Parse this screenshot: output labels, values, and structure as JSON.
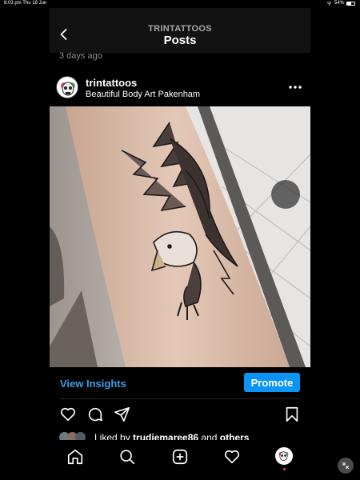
{
  "status_bar": {
    "time_date": "8:03 pm  Thu 18 Jun",
    "battery_text": "54%"
  },
  "header": {
    "account": "TRINTATTOOS",
    "title": "Posts"
  },
  "previous_post": {
    "time_ago": "3 days ago"
  },
  "post": {
    "username": "trintattoos",
    "location": "Beautiful Body Art Pakenham",
    "image_description_icon": "eagle-tattoo-photo"
  },
  "insights": {
    "view_label": "View Insights",
    "promote_label": "Promote"
  },
  "likes": {
    "prefix": "Liked by ",
    "user": "trudiemaree86",
    "middle": " and ",
    "others": "others"
  },
  "colors": {
    "link_blue": "#3f9ee6",
    "promote_blue": "#0a95f6",
    "background": "#000000",
    "topbar": "#121212",
    "notification_dot": "#ed4956"
  }
}
